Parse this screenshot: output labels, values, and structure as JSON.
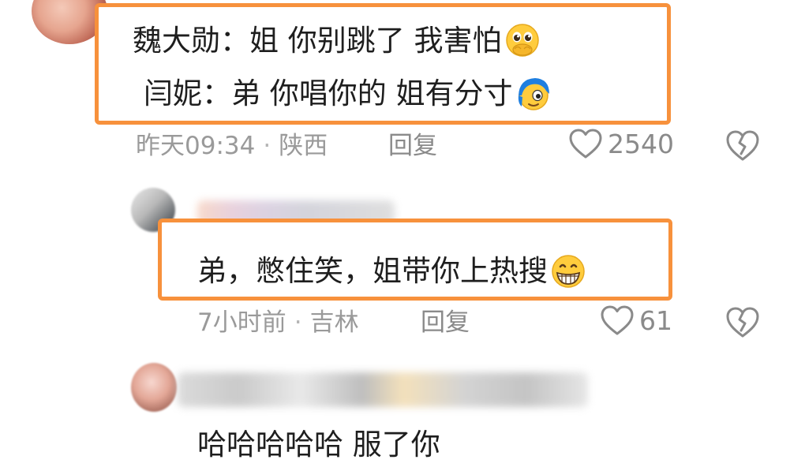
{
  "comments": [
    {
      "lines": [
        "魏大勋：姐 你别跳了 我害怕",
        "闫妮：弟 你唱你的 姐有分寸"
      ],
      "line_emojis": [
        "pleading-face-hands-over-mouth",
        "blue-hair-cool-face"
      ],
      "time": "昨天09:34",
      "separator": "·",
      "location": "陕西",
      "reply_label": "回复",
      "likes": "2540"
    },
    {
      "lines": [
        "弟，憋住笑，姐带你上热搜"
      ],
      "line_emojis": [
        "grinning-face"
      ],
      "time": "7小时前",
      "separator": "·",
      "location": "吉林",
      "reply_label": "回复",
      "likes": "61"
    },
    {
      "lines": [
        "哈哈哈哈哈 服了你"
      ]
    }
  ],
  "colors": {
    "highlight_border": "#f7913c",
    "meta_text": "#9a9a9a",
    "body_text": "#1e1e1e"
  },
  "icons": [
    "heart-outline-icon",
    "broken-heart-icon"
  ]
}
